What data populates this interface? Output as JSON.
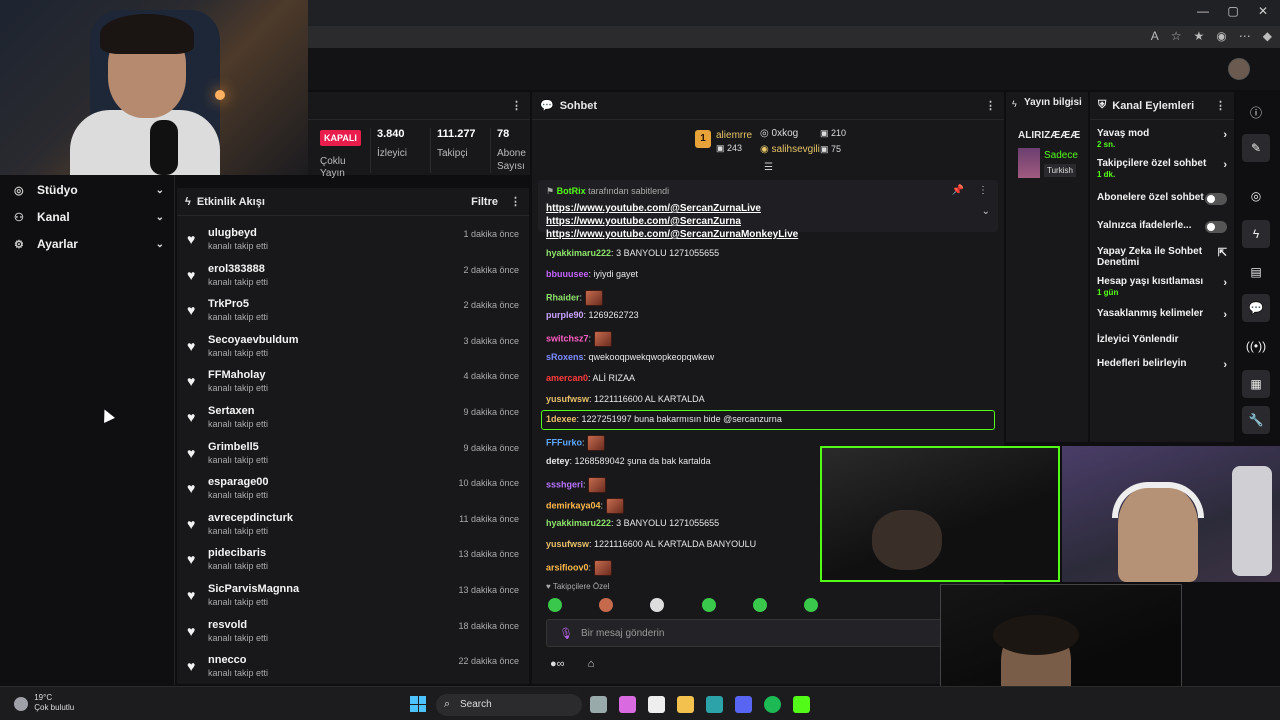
{
  "stats": {
    "badge": "KAPALI",
    "multi_stream": "Çoklu Yayın",
    "items": [
      {
        "value": "3.840",
        "label": "İzleyici"
      },
      {
        "value": "111.277",
        "label": "Takipçi"
      },
      {
        "value": "78",
        "label": "Abone Sayısı"
      }
    ]
  },
  "leftnav": {
    "items": [
      {
        "label": "Stüdyo"
      },
      {
        "label": "Kanal"
      },
      {
        "label": "Ayarlar"
      }
    ]
  },
  "feed": {
    "title": "Etkinlik Akışı",
    "filter_label": "Filtre",
    "action_text": "kanalı takip etti",
    "rows": [
      {
        "user": "ulugbeyd",
        "time": "1 dakika önce"
      },
      {
        "user": "erol383888",
        "time": "2 dakika önce"
      },
      {
        "user": "TrkPro5",
        "time": "2 dakika önce"
      },
      {
        "user": "Secoyaevbuldum",
        "time": "3 dakika önce"
      },
      {
        "user": "FFMaholay",
        "time": "4 dakika önce"
      },
      {
        "user": "Sertaxen",
        "time": "9 dakika önce"
      },
      {
        "user": "Grimbell5",
        "time": "9 dakika önce"
      },
      {
        "user": "esparage00",
        "time": "10 dakika önce"
      },
      {
        "user": "avrecepdincturk",
        "time": "11 dakika önce"
      },
      {
        "user": "pidecibaris",
        "time": "13 dakika önce"
      },
      {
        "user": "SicParvisMagnna",
        "time": "13 dakika önce"
      },
      {
        "user": "resvold",
        "time": "18 dakika önce"
      },
      {
        "user": "nnecco",
        "time": "22 dakika önce"
      }
    ]
  },
  "chat": {
    "title": "Sohbet",
    "top_givers": [
      {
        "user": "aliemrre",
        "amount": "243"
      },
      {
        "user": "0xkog",
        "amount": "210"
      },
      {
        "user": "salihsevgili",
        "amount": "75"
      }
    ],
    "rank_badge": "1",
    "pinned": {
      "author": "BotRix",
      "note": "tarafından sabitlendi",
      "text": "https://www.youtube.com/@SercanZurnaLive https://www.youtube.com/@SercanZurna https://www.youtube.com/@SercanZurnaMonkeyLive"
    },
    "messages": [
      {
        "user": "hyakkimaru222",
        "color": "#8ee36b",
        "text": "3 BANYOLU 1271055655",
        "emote": false
      },
      {
        "user": "bbuuusee",
        "color": "#c264ff",
        "text": "iyiydi gayet",
        "emote": false
      },
      {
        "user": "Rhaider",
        "color": "#8ee36b",
        "text": "",
        "emote": true
      },
      {
        "user": "purple90",
        "color": "#c9a3ff",
        "text": "1269262723",
        "emote": false
      },
      {
        "user": "switchsz7",
        "color": "#ff5ec4",
        "text": "",
        "emote": true
      },
      {
        "user": "sRoxens",
        "color": "#7c8cff",
        "text": "qwekooqpwekqwopkeopqwkew",
        "emote": false
      },
      {
        "user": "amercan0",
        "color": "#ff3b3b",
        "text": "ALİ RIZAA",
        "emote": false
      },
      {
        "user": "yusufwsw",
        "color": "#e8c06a",
        "text": "1221116600 AL KARTALDA",
        "emote": false
      },
      {
        "user": "1dexee",
        "color": "#e8c06a",
        "text": "1227251997 buna bakarmısın bide @sercanzurna",
        "emote": false
      },
      {
        "user": "FFFurko",
        "color": "#5ea8ff",
        "text": "",
        "emote": true
      },
      {
        "user": "detey",
        "color": "#e8e8e8",
        "text": "1268589042 şuna da bak kartalda",
        "emote": false
      },
      {
        "user": "ssshgeri",
        "color": "#b874ff",
        "text": "",
        "emote": true
      },
      {
        "user": "demirkaya04",
        "color": "#ffb84a",
        "text": "",
        "emote": true
      },
      {
        "user": "hyakkimaru222",
        "color": "#8ee36b",
        "text": "3 BANYOLU 1271055655",
        "emote": false
      },
      {
        "user": "yusufwsw",
        "color": "#e8c06a",
        "text": "1221116600 AL KARTALDA BANYOULU",
        "emote": false
      },
      {
        "user": "arsifioov0",
        "color": "#ffb84a",
        "text": "",
        "emote": true
      }
    ],
    "followers_only": "Takipçilere Özel",
    "input_placeholder": "Bir mesaj gönderin"
  },
  "stream_info": {
    "title": "Yayın bilgisi",
    "owner": "ALIRIZÆÆÆ",
    "title_snippet": "Sadece",
    "tag": "Turkish"
  },
  "actions": {
    "title": "Kanal Eylemleri",
    "rows": [
      {
        "label": "Yavaş mod",
        "sub": "2 sn.",
        "control": "arrow"
      },
      {
        "label": "Takipçilere özel sohbet",
        "sub": "1 dk.",
        "control": "arrow"
      },
      {
        "label": "Abonelere özel sohbet",
        "sub": "",
        "control": "toggle"
      },
      {
        "label": "Yalnızca ifadelerle...",
        "sub": "",
        "control": "toggle"
      },
      {
        "label": "Yapay Zeka ile Sohbet Denetimi",
        "sub": "",
        "control": "external"
      },
      {
        "label": "Hesap yaşı kısıtlaması",
        "sub": "1 gün",
        "control": "arrow"
      },
      {
        "label": "Yasaklanmış kelimeler",
        "sub": "",
        "control": "arrow"
      },
      {
        "label": "İzleyici Yönlendir",
        "sub": "",
        "control": "none"
      },
      {
        "label": "Hedefleri belirleyin",
        "sub": "",
        "control": "arrow"
      }
    ]
  },
  "taskbar": {
    "temp": "19°C",
    "weather": "Çok bulutlu",
    "search": "Search"
  },
  "colors": {
    "accent": "#53fc18",
    "live_badge": "#e81d4b"
  }
}
